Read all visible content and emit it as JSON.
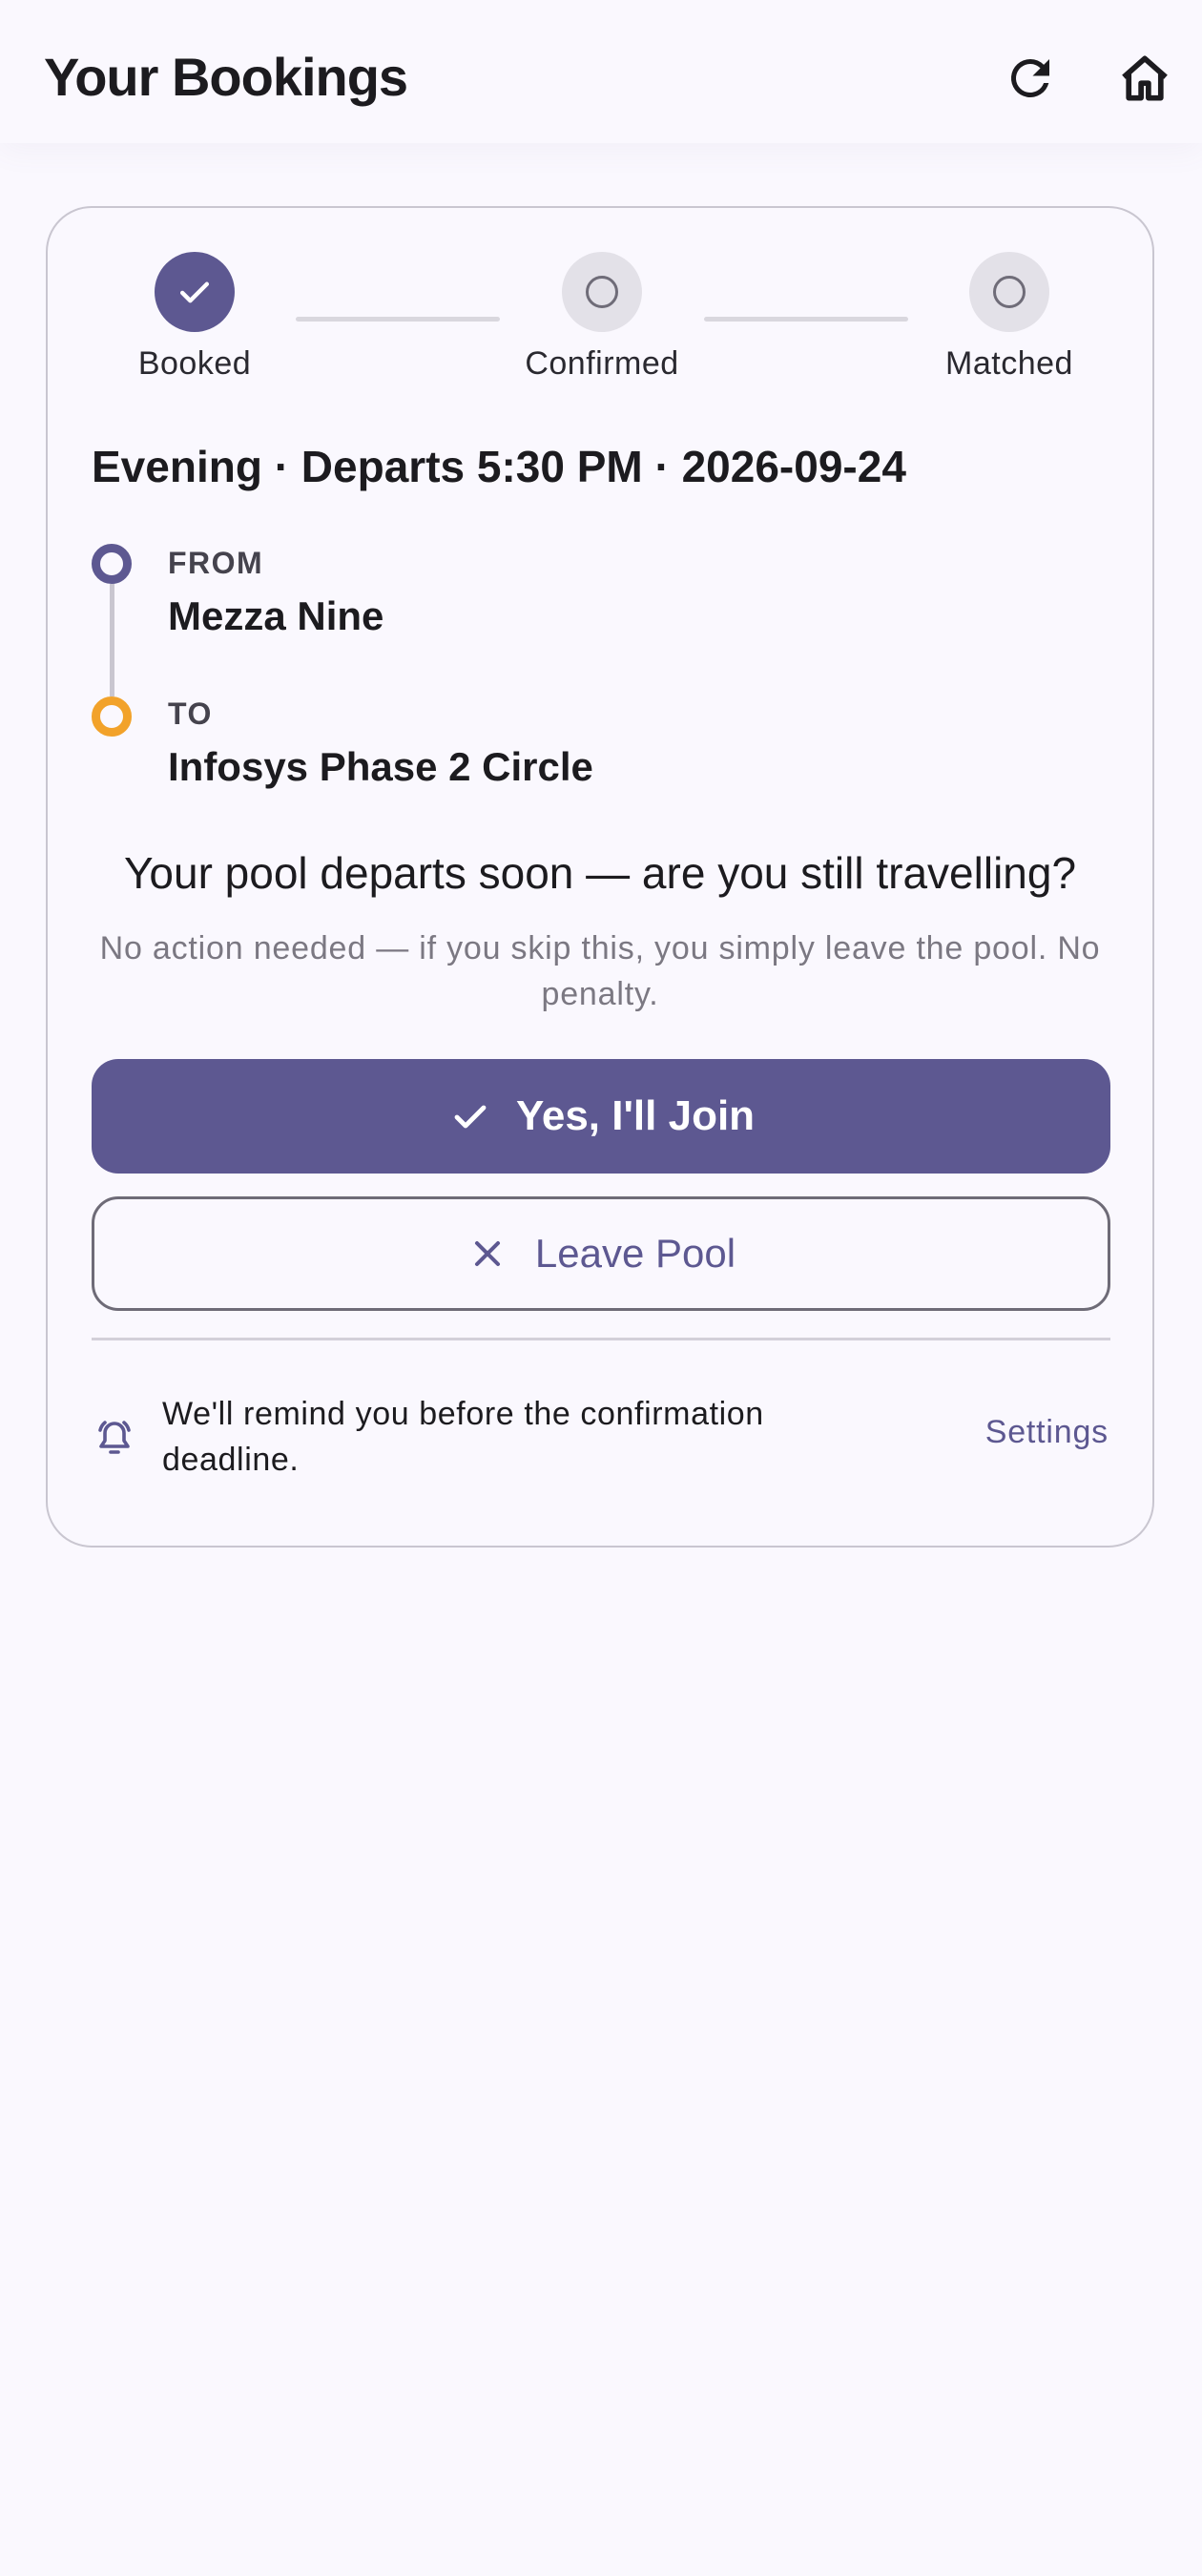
{
  "app_bar": {
    "title": "Your Bookings",
    "actions": [
      {
        "icon": "refresh-icon"
      },
      {
        "icon": "home-icon"
      }
    ]
  },
  "progress": {
    "steps": [
      {
        "label": "Booked",
        "state": "done"
      },
      {
        "label": "Confirmed",
        "state": "pending"
      },
      {
        "label": "Matched",
        "state": "pending"
      }
    ]
  },
  "trip": {
    "title": "Evening · Departs 5:30 PM · 2026-09-24",
    "from_label": "FROM",
    "from_value": "Mezza Nine",
    "to_label": "TO",
    "to_value": "Infosys Phase 2 Circle"
  },
  "prompt": {
    "question": "Your pool departs soon — are you still travelling?",
    "note": "No action needed — if you skip this, you simply leave the pool. No penalty."
  },
  "actions": {
    "join_label": "Yes, I'll Join",
    "leave_label": "Leave Pool"
  },
  "reminder": {
    "text": "We'll remind you before the confirmation deadline.",
    "settings_label": "Settings"
  },
  "colors": {
    "primary": "#5d5891",
    "to_dot": "#f2a22a",
    "background": "#faf8fe"
  }
}
